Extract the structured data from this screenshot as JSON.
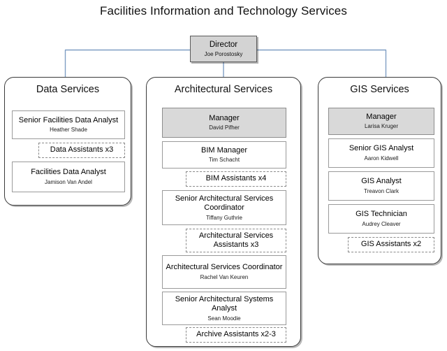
{
  "title": "Facilities Information and Technology Services",
  "colors": {
    "connector": "#7f9ec4",
    "manager_fill": "#d9d9d9",
    "director_fill": "#d3d3d3",
    "box_border": "#9a9a9a",
    "container_border": "#3a3a3a",
    "background": "#ffffff"
  },
  "director": {
    "role": "Director",
    "person": "Joe Porostosky"
  },
  "departments": [
    {
      "id": "data-services",
      "name": "Data Services",
      "roles": [
        {
          "title": "Senior Facilities Data Analyst",
          "person": "Heather Shade",
          "style": "solid"
        },
        {
          "title": "Data Assistants x3",
          "person": "",
          "style": "dashed"
        },
        {
          "title": "Facilities Data Analyst",
          "person": "Jamison Van Andel",
          "style": "solid"
        }
      ]
    },
    {
      "id": "architectural-services",
      "name": "Architectural Services",
      "roles": [
        {
          "title": "Manager",
          "person": "David Pifher",
          "style": "manager"
        },
        {
          "title": "BIM Manager",
          "person": "Tim Schacht",
          "style": "solid"
        },
        {
          "title": "BIM Assistants x4",
          "person": "",
          "style": "dashed"
        },
        {
          "title": "Senior Architectural Services Coordinator",
          "person": "Tiffany Guthrie",
          "style": "solid"
        },
        {
          "title": "Architectural Services Assistants x3",
          "person": "",
          "style": "dashed"
        },
        {
          "title": "Architectural Services Coordinator",
          "person": "Rachel Van Keuren",
          "style": "solid"
        },
        {
          "title": "Senior Architectural Systems Analyst",
          "person": "Sean Moodie",
          "style": "solid"
        },
        {
          "title": "Archive Assistants x2-3",
          "person": "",
          "style": "dashed"
        }
      ]
    },
    {
      "id": "gis-services",
      "name": "GIS Services",
      "roles": [
        {
          "title": "Manager",
          "person": "Larisa Kruger",
          "style": "manager"
        },
        {
          "title": "Senior GIS Analyst",
          "person": "Aaron Kidwell",
          "style": "solid"
        },
        {
          "title": "GIS Analyst",
          "person": "Treavon Clark",
          "style": "solid"
        },
        {
          "title": "GIS Technician",
          "person": "Audrey Cleaver",
          "style": "solid"
        },
        {
          "title": "GIS Assistants x2",
          "person": "",
          "style": "dashed"
        }
      ]
    }
  ]
}
